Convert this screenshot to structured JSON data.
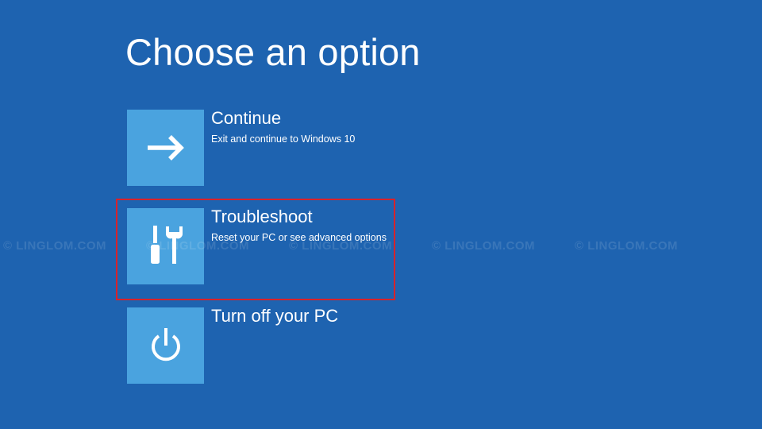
{
  "page": {
    "title": "Choose an option"
  },
  "options": [
    {
      "label": "Continue",
      "description": "Exit and continue to Windows 10",
      "icon": "arrow-right-icon"
    },
    {
      "label": "Troubleshoot",
      "description": "Reset your PC or see advanced options",
      "icon": "tools-icon"
    },
    {
      "label": "Turn off your PC",
      "description": "",
      "icon": "power-icon"
    }
  ],
  "watermark": {
    "text": "© LINGLOM.COM"
  },
  "colors": {
    "background": "#1e63b0",
    "tile": "#4aa3df",
    "highlight": "#d8222b",
    "text": "#ffffff"
  }
}
